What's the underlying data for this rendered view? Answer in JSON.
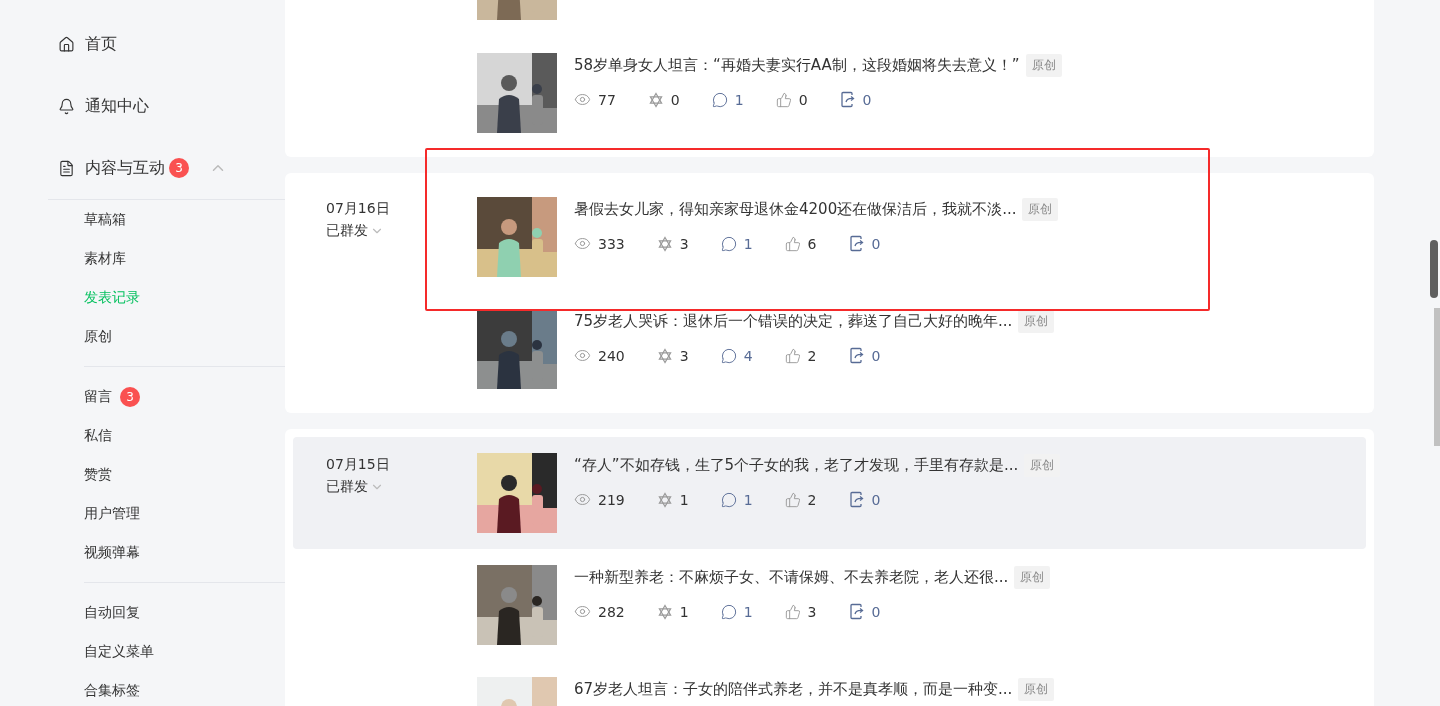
{
  "sidebar": {
    "items": [
      {
        "label": "首页"
      },
      {
        "label": "通知中心"
      },
      {
        "label": "内容与互动",
        "badge": "3",
        "expanded": true,
        "groups": [
          {
            "children": [
              {
                "label": "草稿箱",
                "selected": false
              },
              {
                "label": "素材库",
                "selected": false
              },
              {
                "label": "发表记录",
                "selected": true
              },
              {
                "label": "原创",
                "selected": false
              }
            ]
          },
          {
            "children": [
              {
                "label": "留言",
                "badge": "3",
                "selected": false
              },
              {
                "label": "私信",
                "selected": false
              },
              {
                "label": "赞赏",
                "selected": false
              },
              {
                "label": "用户管理",
                "selected": false
              },
              {
                "label": "视频弹幕",
                "selected": false
              }
            ]
          },
          {
            "children": [
              {
                "label": "自动回复",
                "selected": false
              },
              {
                "label": "自定义菜单",
                "selected": false
              },
              {
                "label": "合集标签",
                "selected": false
              }
            ]
          }
        ]
      }
    ]
  },
  "groups": [
    {
      "articles": [
        {
          "kind": "cut"
        },
        {
          "kind": "article",
          "title": "58岁单身女人坦言：“再婚夫妻实行AA制，这段婚姻将失去意义！”",
          "tag": "原创",
          "views": "77",
          "favorites": "0",
          "comments": "1",
          "likes": "0",
          "shares": "0",
          "hovered": false
        }
      ]
    },
    {
      "date": "07月16日",
      "status": "已群发",
      "articles": [
        {
          "kind": "article",
          "title": "暑假去女儿家，得知亲家母退休金4200还在做保洁后，我就不淡...",
          "tag": "原创",
          "views": "333",
          "favorites": "3",
          "comments": "1",
          "likes": "6",
          "shares": "0",
          "hovered": false
        },
        {
          "kind": "article",
          "title": "75岁老人哭诉：退休后一个错误的决定，葬送了自己大好的晚年...",
          "tag": "原创",
          "views": "240",
          "favorites": "3",
          "comments": "4",
          "likes": "2",
          "shares": "0",
          "hovered": false
        }
      ]
    },
    {
      "date": "07月15日",
      "status": "已群发",
      "articles": [
        {
          "kind": "article",
          "title": "“存人”不如存钱，生了5个子女的我，老了才发现，手里有存款是...",
          "tag": "原创",
          "views": "219",
          "favorites": "1",
          "comments": "1",
          "likes": "2",
          "shares": "0",
          "hovered": true
        },
        {
          "kind": "article",
          "title": "一种新型养老：不麻烦子女、不请保姆、不去养老院，老人还很...",
          "tag": "原创",
          "views": "282",
          "favorites": "1",
          "comments": "1",
          "likes": "3",
          "shares": "0",
          "hovered": false
        },
        {
          "kind": "article",
          "title": "67岁老人坦言：子女的陪伴式养老，并不是真孝顺，而是一种变...",
          "tag": "原创",
          "hovered": false
        }
      ]
    }
  ]
}
